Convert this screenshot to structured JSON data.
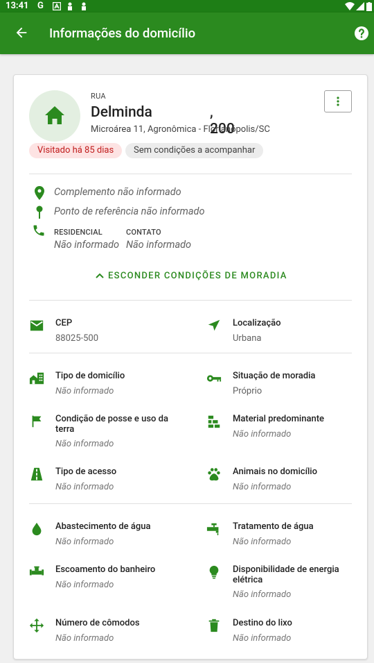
{
  "status_bar": {
    "time": "13:41",
    "g": "G"
  },
  "app_bar": {
    "title": "Informações do domicílio"
  },
  "header": {
    "type_label": "RUA",
    "street_name": "Delminda",
    "street_number": ", 200",
    "address_line": "Microárea 11, Agronômica - Florianópolis/SC"
  },
  "chips": {
    "visited": "Visitado há 85 dias",
    "conditions": "Sem condições a acompanhar"
  },
  "details": {
    "complement": "Complemento não informado",
    "reference": "Ponto de referência não informado",
    "phone_residential_label": "RESIDENCIAL",
    "phone_residential_value": "Não informado",
    "phone_contact_label": "CONTATO",
    "phone_contact_value": "Não informado"
  },
  "toggle_label": "ESCONDER CONDIÇÕES DE MORADIA",
  "fields": {
    "cep": {
      "label": "CEP",
      "value": "88025-500"
    },
    "localizacao": {
      "label": "Localização",
      "value": "Urbana"
    },
    "tipo_domicilio": {
      "label": "Tipo de domicílio",
      "value": "Não informado"
    },
    "situacao_moradia": {
      "label": "Situação de moradia",
      "value": "Próprio"
    },
    "posse_terra": {
      "label": "Condição de posse e uso da terra",
      "value": "Não informado"
    },
    "material": {
      "label": "Material predominante",
      "value": "Não informado"
    },
    "tipo_acesso": {
      "label": "Tipo de acesso",
      "value": "Não informado"
    },
    "animais": {
      "label": "Animais no domicílio",
      "value": "Não informado"
    },
    "abastecimento": {
      "label": "Abastecimento de água",
      "value": "Não informado"
    },
    "tratamento": {
      "label": "Tratamento de água",
      "value": "Não informado"
    },
    "escoamento": {
      "label": "Escoamento do banheiro",
      "value": "Não informado"
    },
    "energia": {
      "label": "Disponibilidade de energia elétrica",
      "value": "Não informado"
    },
    "comodos": {
      "label": "Número de cômodos",
      "value": "Não informado"
    },
    "lixo": {
      "label": "Destino do lixo",
      "value": "Não informado"
    }
  },
  "colors": {
    "primary": "#2b8a1f",
    "status_bar": "#1e7e16",
    "chip_red_bg": "#fde3e3",
    "chip_red_text": "#c01c1c"
  }
}
